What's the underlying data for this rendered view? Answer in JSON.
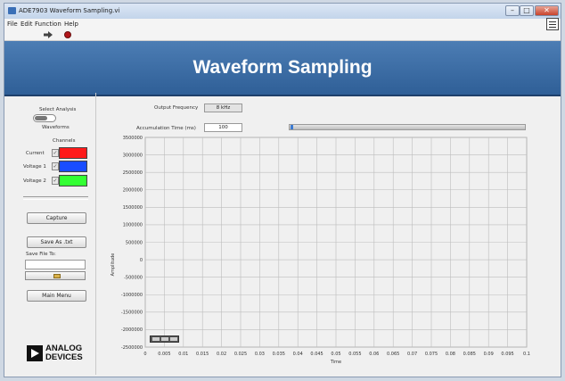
{
  "window": {
    "title": "ADE7903 Waveform Sampling.vi"
  },
  "menu": [
    "File",
    "Edit",
    "Function",
    "Help"
  ],
  "banner": {
    "title": "Waveform Sampling"
  },
  "analysis": {
    "select_label": "Select Analysis",
    "mode_label": "Waveforms"
  },
  "channels": {
    "header": "Channels",
    "items": [
      {
        "label": "Current",
        "checked": true,
        "color": "#ff1a1a"
      },
      {
        "label": "Voltage 1",
        "checked": true,
        "color": "#1a4dff"
      },
      {
        "label": "Voltage 2",
        "checked": true,
        "color": "#33ff33"
      }
    ]
  },
  "buttons": {
    "capture": "Capture",
    "save": "Save As .txt",
    "main_menu": "Main Menu"
  },
  "save_file": {
    "label": "Save File To:",
    "path": ""
  },
  "controls": {
    "output_frequency_label": "Output Frequency",
    "output_frequency_value": "8 kHz",
    "accumulation_label": "Accumulation Time (ms)",
    "accumulation_value": "100",
    "progress": 0.01
  },
  "logo": {
    "line1": "ANALOG",
    "line2": "DEVICES"
  },
  "chart_data": {
    "type": "line",
    "xlabel": "Time",
    "ylabel": "Amplitude",
    "xlim": [
      0,
      0.1
    ],
    "ylim": [
      -2500000,
      3500000
    ],
    "x_ticks": [
      "0",
      "0.005",
      "0.01",
      "0.015",
      "0.02",
      "0.025",
      "0.03",
      "0.035",
      "0.04",
      "0.045",
      "0.05",
      "0.055",
      "0.06",
      "0.065",
      "0.07",
      "0.075",
      "0.08",
      "0.085",
      "0.09",
      "0.095",
      "0.1"
    ],
    "y_ticks": [
      "3500000",
      "3000000",
      "2500000",
      "2000000",
      "1500000",
      "1000000",
      "500000",
      "0",
      "-500000",
      "-1000000",
      "-1500000",
      "-2000000",
      "-2500000"
    ],
    "grid": true,
    "series": []
  }
}
